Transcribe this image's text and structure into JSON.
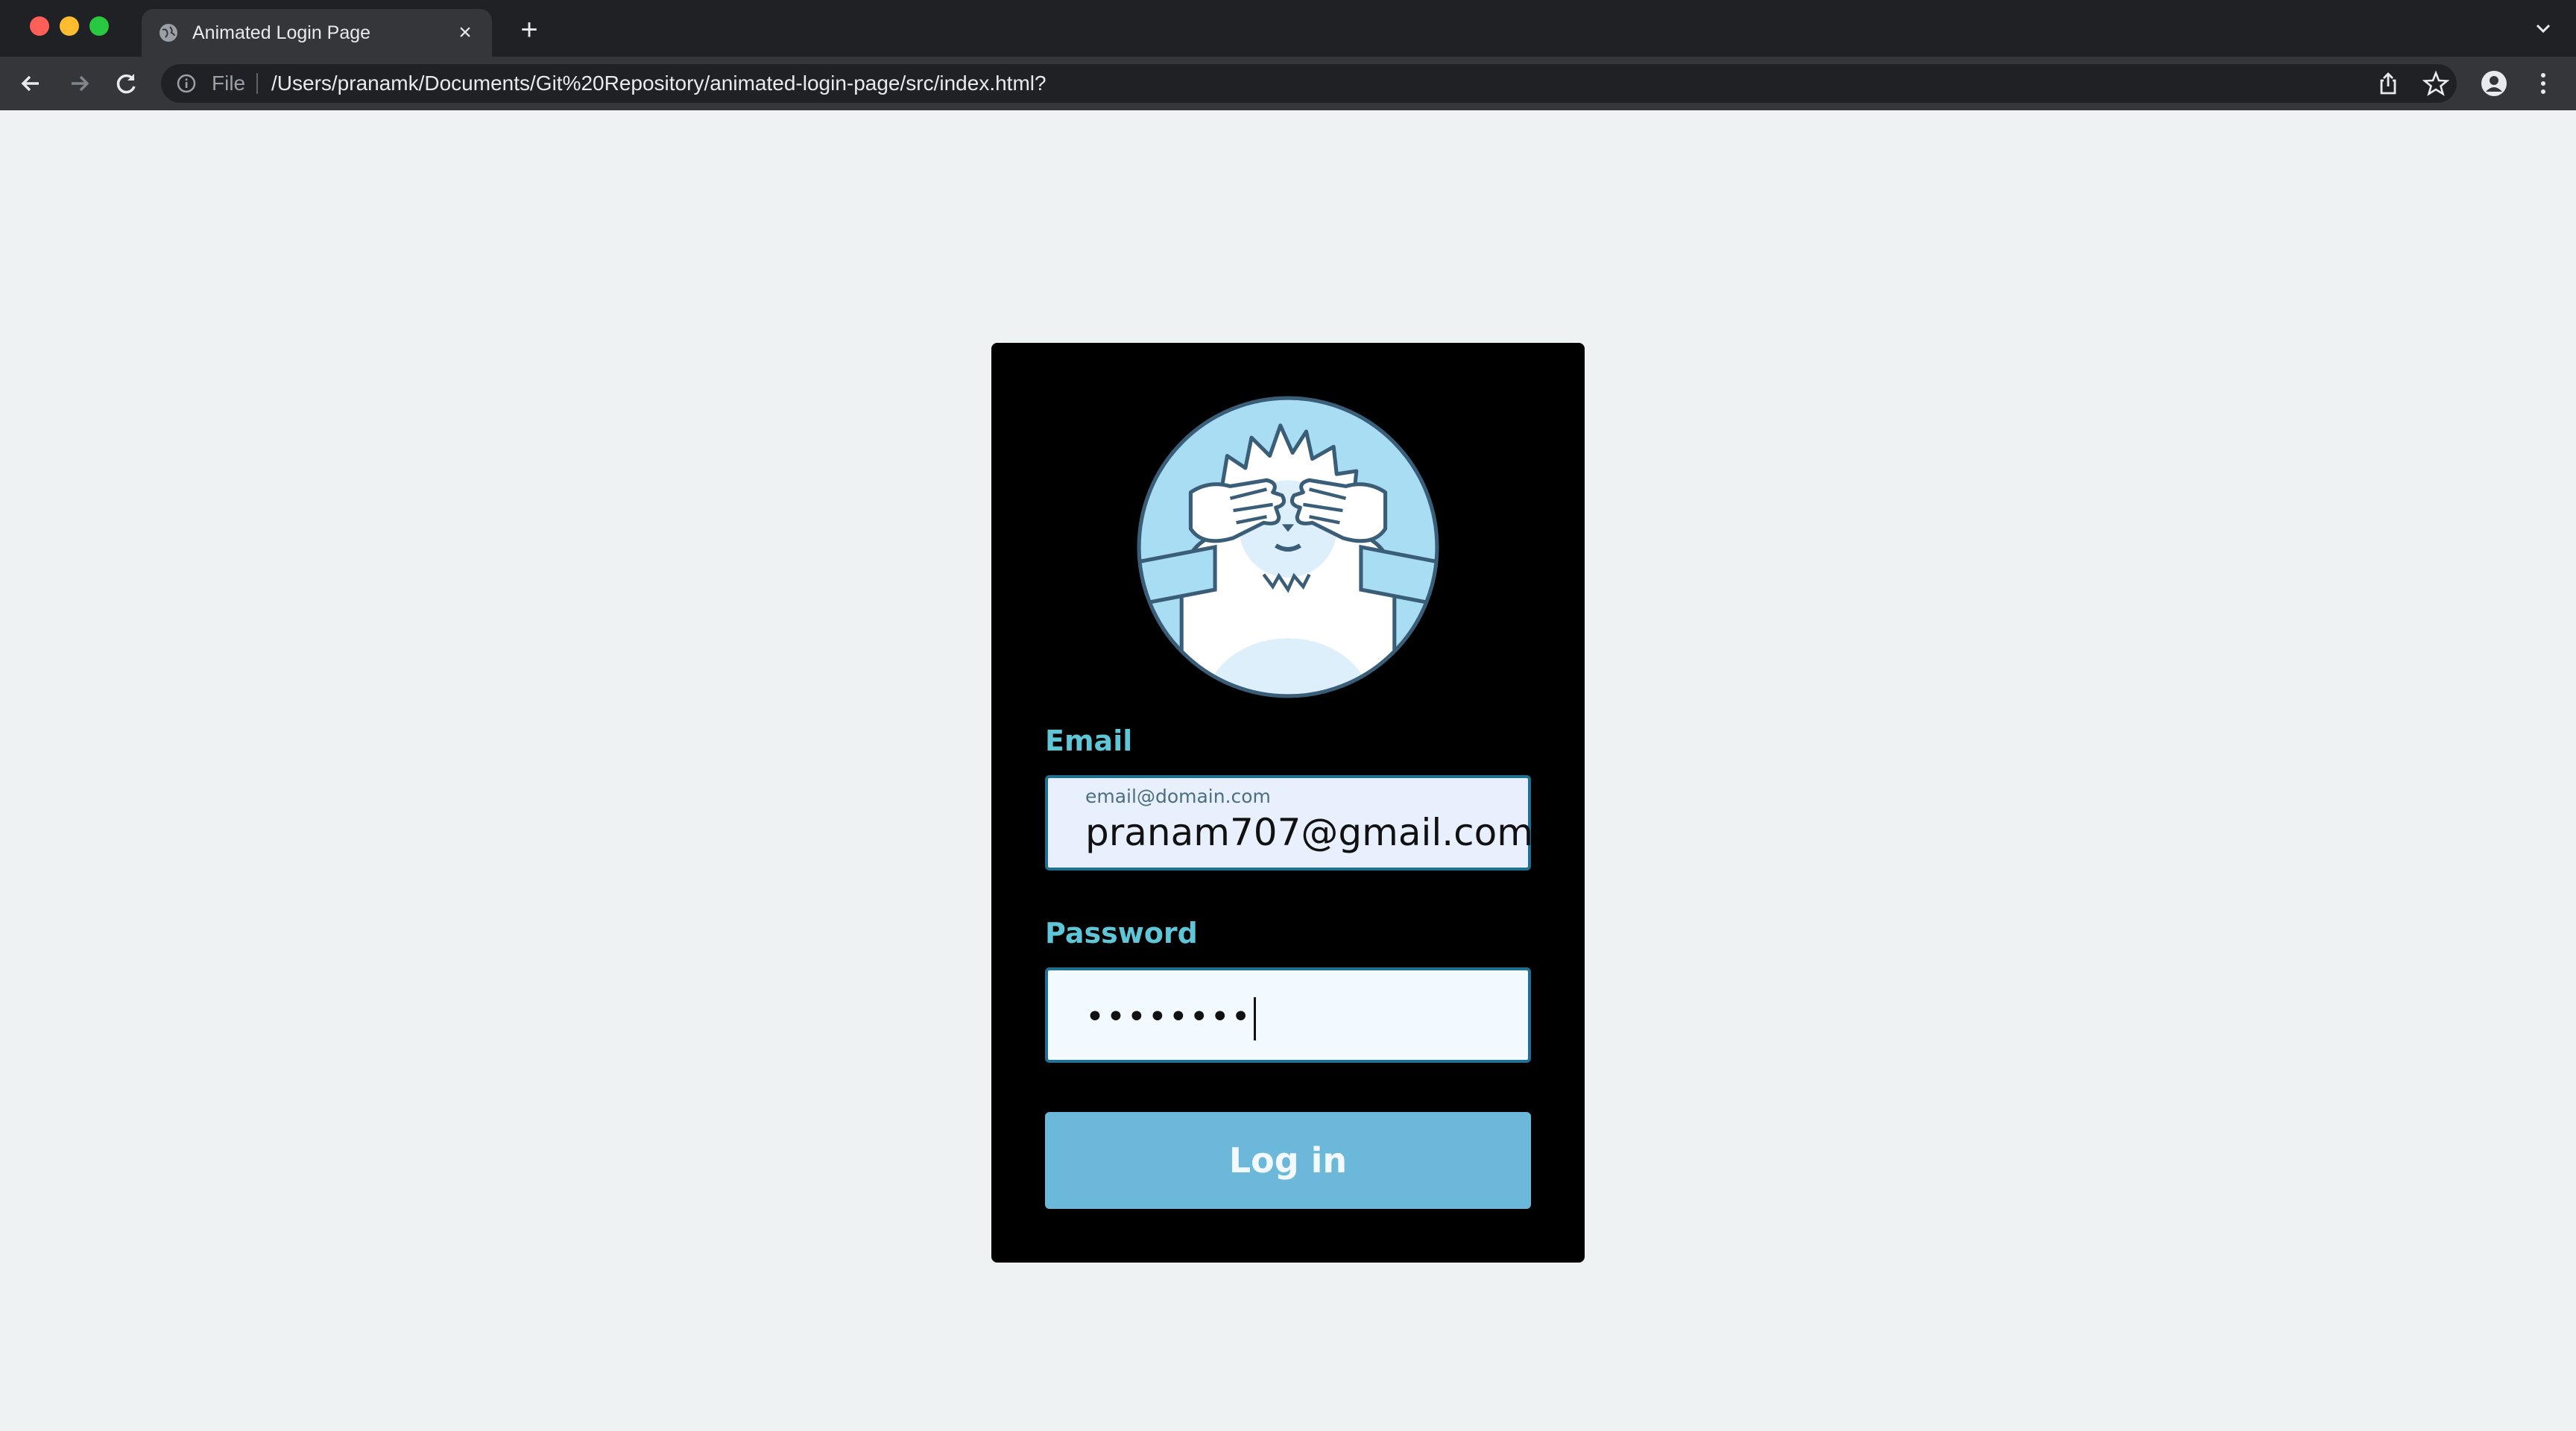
{
  "browser": {
    "tab_title": "Animated Login Page",
    "tab_close_glyph": "×",
    "new_tab_glyph": "+",
    "scheme_label": "File",
    "url": "/Users/pranamk/Documents/Git%20Repository/animated-login-page/src/index.html?",
    "icons": [
      "globe-icon",
      "chevron-down-icon",
      "back-arrow-icon",
      "forward-arrow-icon",
      "reload-icon",
      "info-icon",
      "share-icon",
      "star-icon",
      "profile-icon",
      "kebab-menu-icon"
    ]
  },
  "login": {
    "email_label": "Email",
    "email_placeholder": "email@domain.com",
    "email_value": "pranam707@gmail.com",
    "password_label": "Password",
    "password_masked": "••••••••",
    "login_button": "Log in"
  },
  "colors": {
    "background": "#eef2f3",
    "card": "#000000",
    "label": "#5fc6d7",
    "input_border": "#217093",
    "button": "#6bb8da",
    "yeti_fill": "#ffffff",
    "yeti_blue": "#a9ddf3",
    "yeti_outline": "#3a5e77"
  }
}
